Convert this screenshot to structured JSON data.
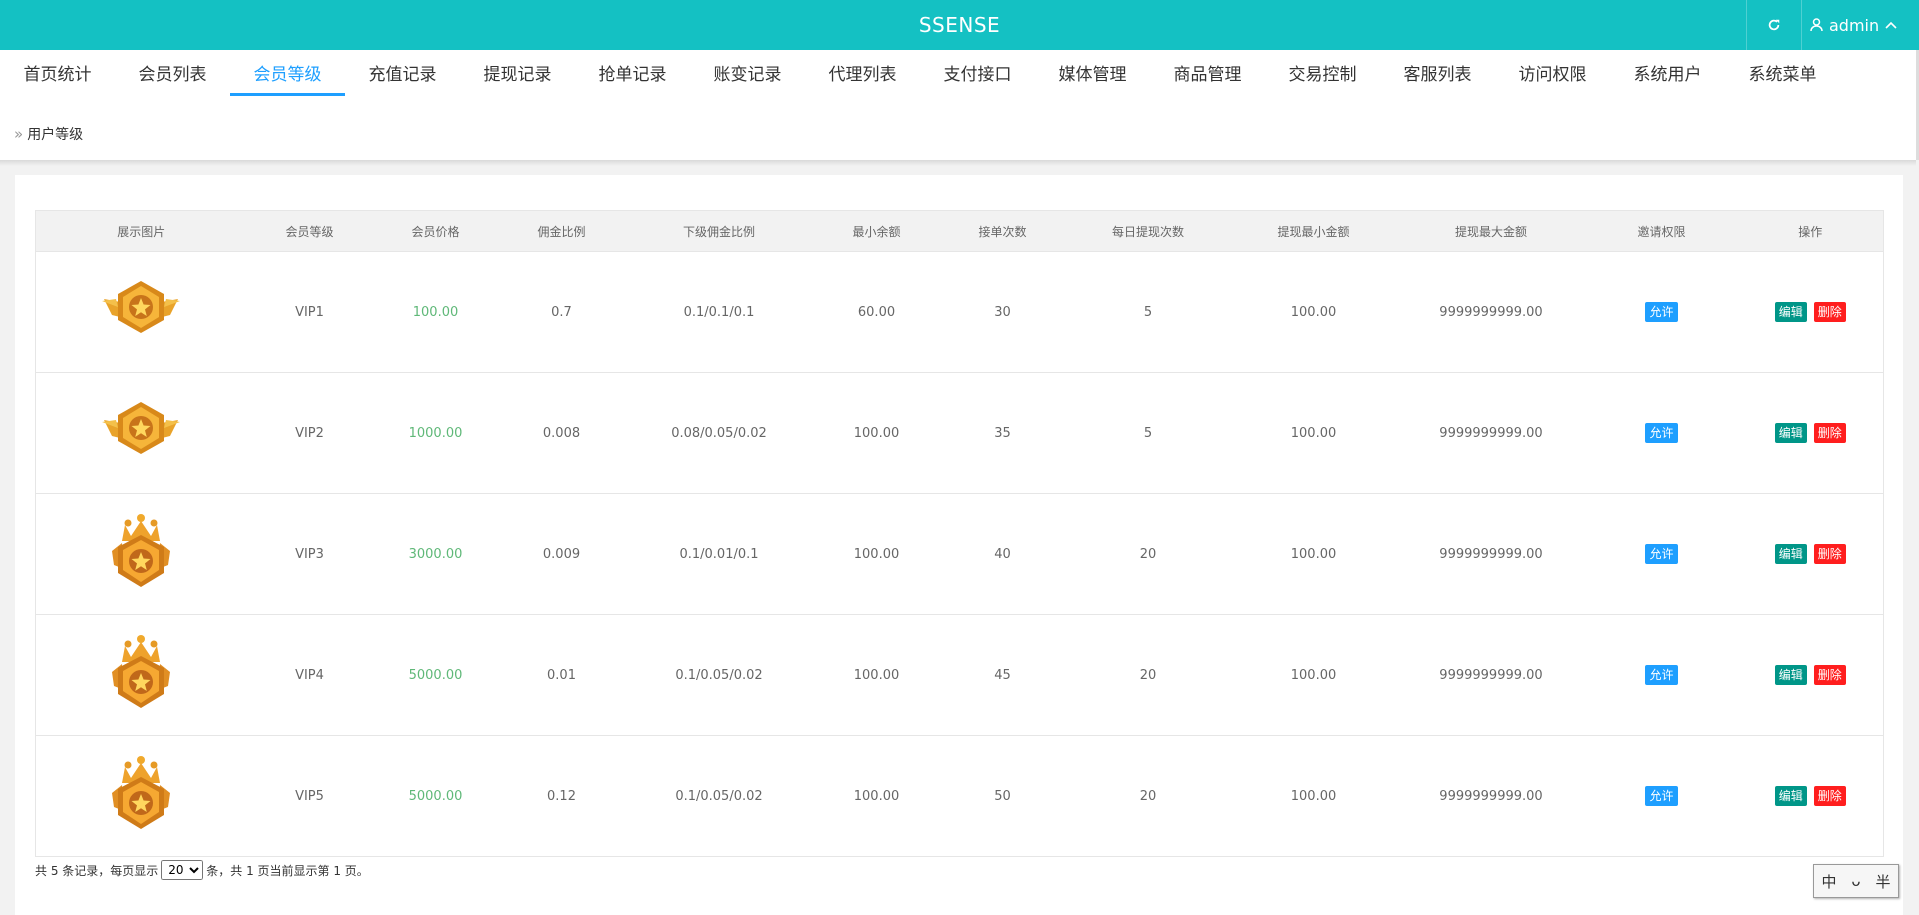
{
  "header": {
    "brand": "SSENSE",
    "user": "admin"
  },
  "tabs": [
    {
      "label": "首页统计",
      "active": false
    },
    {
      "label": "会员列表",
      "active": false
    },
    {
      "label": "会员等级",
      "active": true
    },
    {
      "label": "充值记录",
      "active": false
    },
    {
      "label": "提现记录",
      "active": false
    },
    {
      "label": "抢单记录",
      "active": false
    },
    {
      "label": "账变记录",
      "active": false
    },
    {
      "label": "代理列表",
      "active": false
    },
    {
      "label": "支付接口",
      "active": false
    },
    {
      "label": "媒体管理",
      "active": false
    },
    {
      "label": "商品管理",
      "active": false
    },
    {
      "label": "交易控制",
      "active": false
    },
    {
      "label": "客服列表",
      "active": false
    },
    {
      "label": "访问权限",
      "active": false
    },
    {
      "label": "系统用户",
      "active": false
    },
    {
      "label": "系统菜单",
      "active": false
    }
  ],
  "breadcrumb": {
    "current": "用户等级"
  },
  "table": {
    "columns": [
      "展示图片",
      "会员等级",
      "会员价格",
      "佣金比例",
      "下级佣金比例",
      "最小余额",
      "接单次数",
      "每日提现次数",
      "提现最小金额",
      "提现最大金额",
      "邀请权限",
      "操作"
    ],
    "rows": [
      {
        "badge": "winged-star-badge",
        "level": "VIP1",
        "price": "100.00",
        "commission": "0.7",
        "sub_commission": "0.1/0.1/0.1",
        "min_balance": "60.00",
        "orders": "30",
        "daily_withdrawals": "5",
        "withdraw_min": "100.00",
        "withdraw_max": "9999999999.00",
        "invite": "允许"
      },
      {
        "badge": "winged-star-badge",
        "level": "VIP2",
        "price": "1000.00",
        "commission": "0.008",
        "sub_commission": "0.08/0.05/0.02",
        "min_balance": "100.00",
        "orders": "35",
        "daily_withdrawals": "5",
        "withdraw_min": "100.00",
        "withdraw_max": "9999999999.00",
        "invite": "允许"
      },
      {
        "badge": "crown-star-badge",
        "level": "VIP3",
        "price": "3000.00",
        "commission": "0.009",
        "sub_commission": "0.1/0.01/0.1",
        "min_balance": "100.00",
        "orders": "40",
        "daily_withdrawals": "20",
        "withdraw_min": "100.00",
        "withdraw_max": "9999999999.00",
        "invite": "允许"
      },
      {
        "badge": "crown-star-badge",
        "level": "VIP4",
        "price": "5000.00",
        "commission": "0.01",
        "sub_commission": "0.1/0.05/0.02",
        "min_balance": "100.00",
        "orders": "45",
        "daily_withdrawals": "20",
        "withdraw_min": "100.00",
        "withdraw_max": "9999999999.00",
        "invite": "允许"
      },
      {
        "badge": "crown-star-badge",
        "level": "VIP5",
        "price": "5000.00",
        "commission": "0.12",
        "sub_commission": "0.1/0.05/0.02",
        "min_balance": "100.00",
        "orders": "50",
        "daily_withdrawals": "20",
        "withdraw_min": "100.00",
        "withdraw_max": "9999999999.00",
        "invite": "允许"
      }
    ],
    "actions": {
      "edit": "编辑",
      "delete": "删除"
    }
  },
  "pagination": {
    "prefix": "共 5 条记录，每页显示",
    "page_size": "20",
    "suffix": "条，共 1 页当前显示第 1 页。"
  },
  "ime": {
    "chars": [
      "中",
      "ᴗ",
      "半"
    ]
  },
  "colors": {
    "header": "#14c1c3",
    "accent": "#1e9fff",
    "price": "#5fb878",
    "edit": "#009688",
    "delete": "#ff1e1e"
  }
}
